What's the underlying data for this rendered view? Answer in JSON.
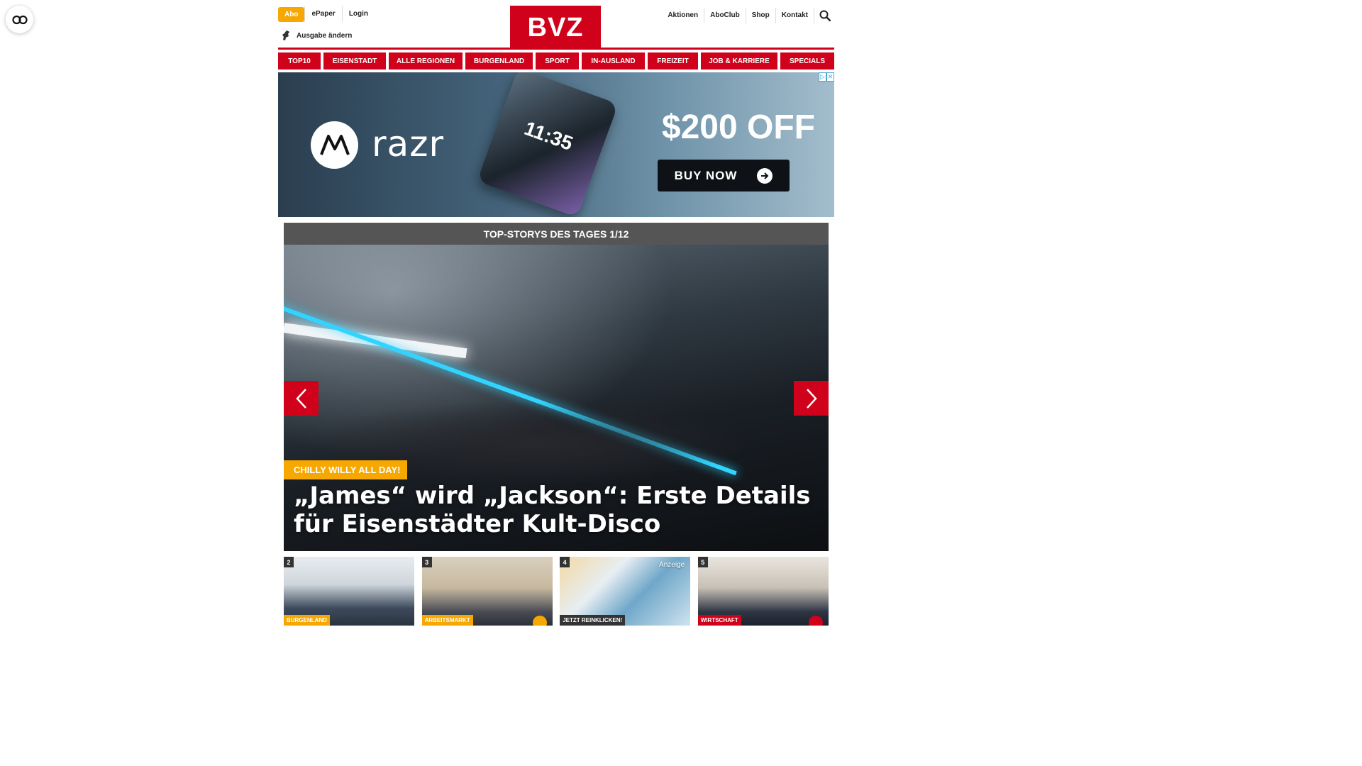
{
  "header": {
    "abo_label": "Abo",
    "epaper_label": "ePaper",
    "login_label": "Login",
    "ausgabe_label": "Ausgabe ändern",
    "logo_text": "BVZ",
    "right_links": [
      "Aktionen",
      "AboClub",
      "Shop",
      "Kontakt"
    ],
    "search_icon": "search-icon"
  },
  "nav": {
    "items": [
      "TOP10",
      "EISENSTADT",
      "ALLE REGIONEN",
      "BURGENLAND",
      "SPORT",
      "IN-AUSLAND",
      "FREIZEIT",
      "JOB & KARRIERE",
      "SPECIALS"
    ]
  },
  "ad": {
    "brand": "razr",
    "phone_time": "11:35",
    "headline": "$200 OFF",
    "cta": "BUY NOW"
  },
  "stories": {
    "header": "TOP-STORYS DES TAGES 1/12",
    "hero_tag": "CHILLY WILLY ALL DAY!",
    "hero_title": "„James“ wird „Jackson“: Erste Details für Eisenstädter Kult-Disco",
    "thumbs": [
      {
        "num": "2",
        "category": "BURGENLAND"
      },
      {
        "num": "3",
        "category": "ARBEITSMARKT"
      },
      {
        "num": "4",
        "category": "JETZT REINKLICKEN!",
        "anzeige": "Anzeige"
      },
      {
        "num": "5",
        "category": "WIRTSCHAFT"
      }
    ]
  },
  "colors": {
    "brand_red": "#d0021b",
    "accent_amber": "#f6a800",
    "header_gray": "#555555"
  }
}
